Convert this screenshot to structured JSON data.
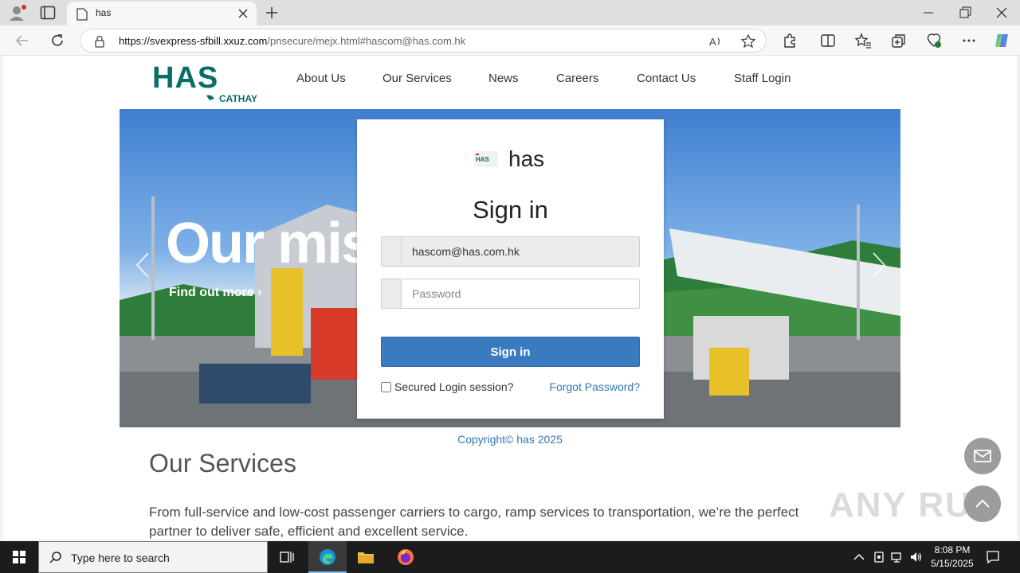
{
  "browser": {
    "tab_title": "has",
    "url_host": "https://svexpress-sfbill.xxuz.com",
    "url_path": "/pnsecure/mejx.html#hascom@has.com.hk"
  },
  "site": {
    "logo_text": "HAS",
    "logo_sub": "CATHAY",
    "nav": [
      "About Us",
      "Our Services",
      "News",
      "Careers",
      "Contact Us",
      "Staff Login"
    ]
  },
  "hero": {
    "headline": "Our mis",
    "cta": "Find out more ›"
  },
  "login": {
    "brand_logo_text": "HAS",
    "brand": "has",
    "heading": "Sign in",
    "email_value": "hascom@has.com.hk",
    "password_placeholder": "Password",
    "submit": "Sign in",
    "remember": "Secured Login session?",
    "forgot": "Forgot Password?"
  },
  "footer": {
    "copyright": "Copyright© has 2025"
  },
  "services": {
    "title": "Our Services",
    "text": "From full-service and low-cost passenger carriers to cargo, ramp services to transportation, we’re the perfect partner to deliver safe, efficient and excellent service."
  },
  "watermark": "ANY RUN",
  "taskbar": {
    "search_placeholder": "Type here to search",
    "time": "8:08 PM",
    "date": "5/15/2025"
  },
  "colors": {
    "brand_green": "#0a6e68",
    "link_blue": "#337ab7",
    "button_blue": "#3a7bbf"
  }
}
